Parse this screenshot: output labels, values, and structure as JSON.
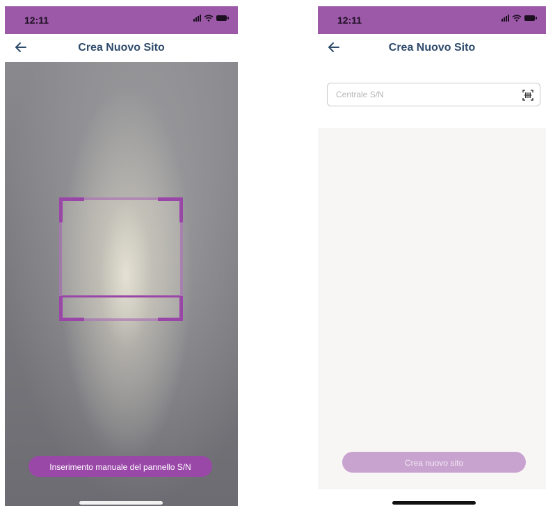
{
  "left_screen": {
    "status_bar": {
      "time": "12:11"
    },
    "header": {
      "title": "Crea Nuovo Sito"
    },
    "camera": {
      "manual_button_label": "Inserimento manuale del pannello S/N"
    }
  },
  "right_screen": {
    "status_bar": {
      "time": "12:11"
    },
    "header": {
      "title": "Crea Nuovo Sito"
    },
    "form": {
      "serial_placeholder": "Centrale S/N",
      "serial_value": "",
      "create_button_label": "Crea nuovo sito"
    }
  },
  "colors": {
    "status_bar": "#9c59a8",
    "accent_purple": "#9a48a8",
    "disabled_button": "#c9a3d0",
    "title_text": "#2e4a6b"
  },
  "icons": {
    "back": "arrow-left-icon",
    "scan": "barcode-scan-icon",
    "signal": "signal-icon",
    "wifi": "wifi-icon",
    "battery": "battery-icon"
  }
}
